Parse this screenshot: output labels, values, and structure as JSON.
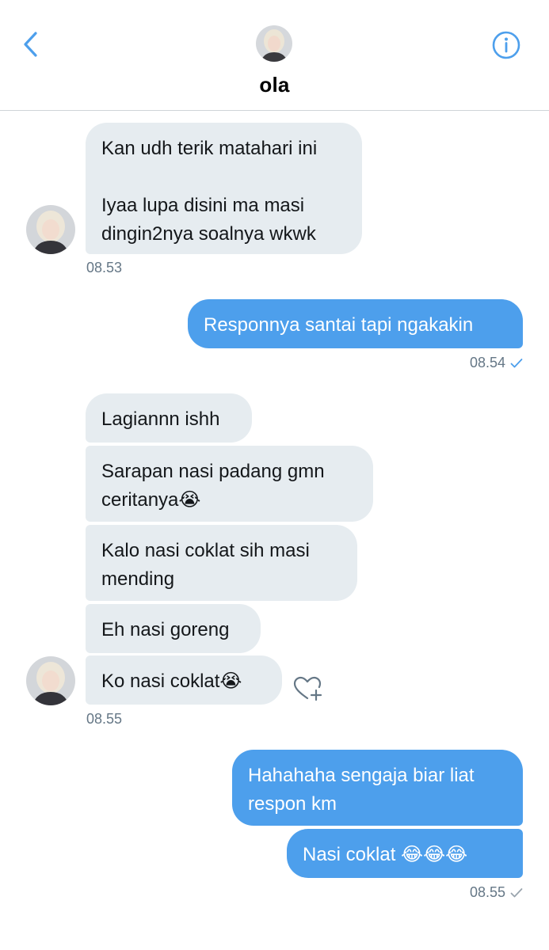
{
  "header": {
    "contact_name": "ola",
    "back_icon": "chevron-left-icon",
    "info_icon": "info-circle-icon",
    "accent_color": "#4d9fec"
  },
  "messages": [
    {
      "id": "m1",
      "direction": "incoming",
      "text": "Kan udh terik matahari ini\n\nIyaa lupa disini ma masi\ndingin2nya soalnya wkwk"
    },
    {
      "id": "m2",
      "direction": "outgoing",
      "text": "Responnya santai tapi ngakakin"
    },
    {
      "id": "m3",
      "direction": "incoming",
      "text": "Lagiannn ishh"
    },
    {
      "id": "m4",
      "direction": "incoming",
      "text": "Sarapan nasi padang gmn\nceritanya😭"
    },
    {
      "id": "m5",
      "direction": "incoming",
      "text": "Kalo nasi coklat sih masi\nmending"
    },
    {
      "id": "m6",
      "direction": "incoming",
      "text": "Eh nasi goreng"
    },
    {
      "id": "m7",
      "direction": "incoming",
      "text": "Ko nasi coklat😭"
    },
    {
      "id": "m8",
      "direction": "outgoing",
      "text": "Hahahaha sengaja biar liat\nrespon km"
    },
    {
      "id": "m9",
      "direction": "outgoing",
      "text": "Nasi coklat 😂😂😂"
    }
  ],
  "timestamps": {
    "t1": "08.53",
    "t2": "08.54",
    "t3": "08.55",
    "t4": "08.55"
  },
  "colors": {
    "incoming_bubble": "#e6ecf0",
    "outgoing_bubble": "#4d9fec",
    "timestamp_text": "#657786"
  },
  "icons": {
    "read_receipt": "checkmark-icon",
    "react": "heart-plus-icon"
  }
}
